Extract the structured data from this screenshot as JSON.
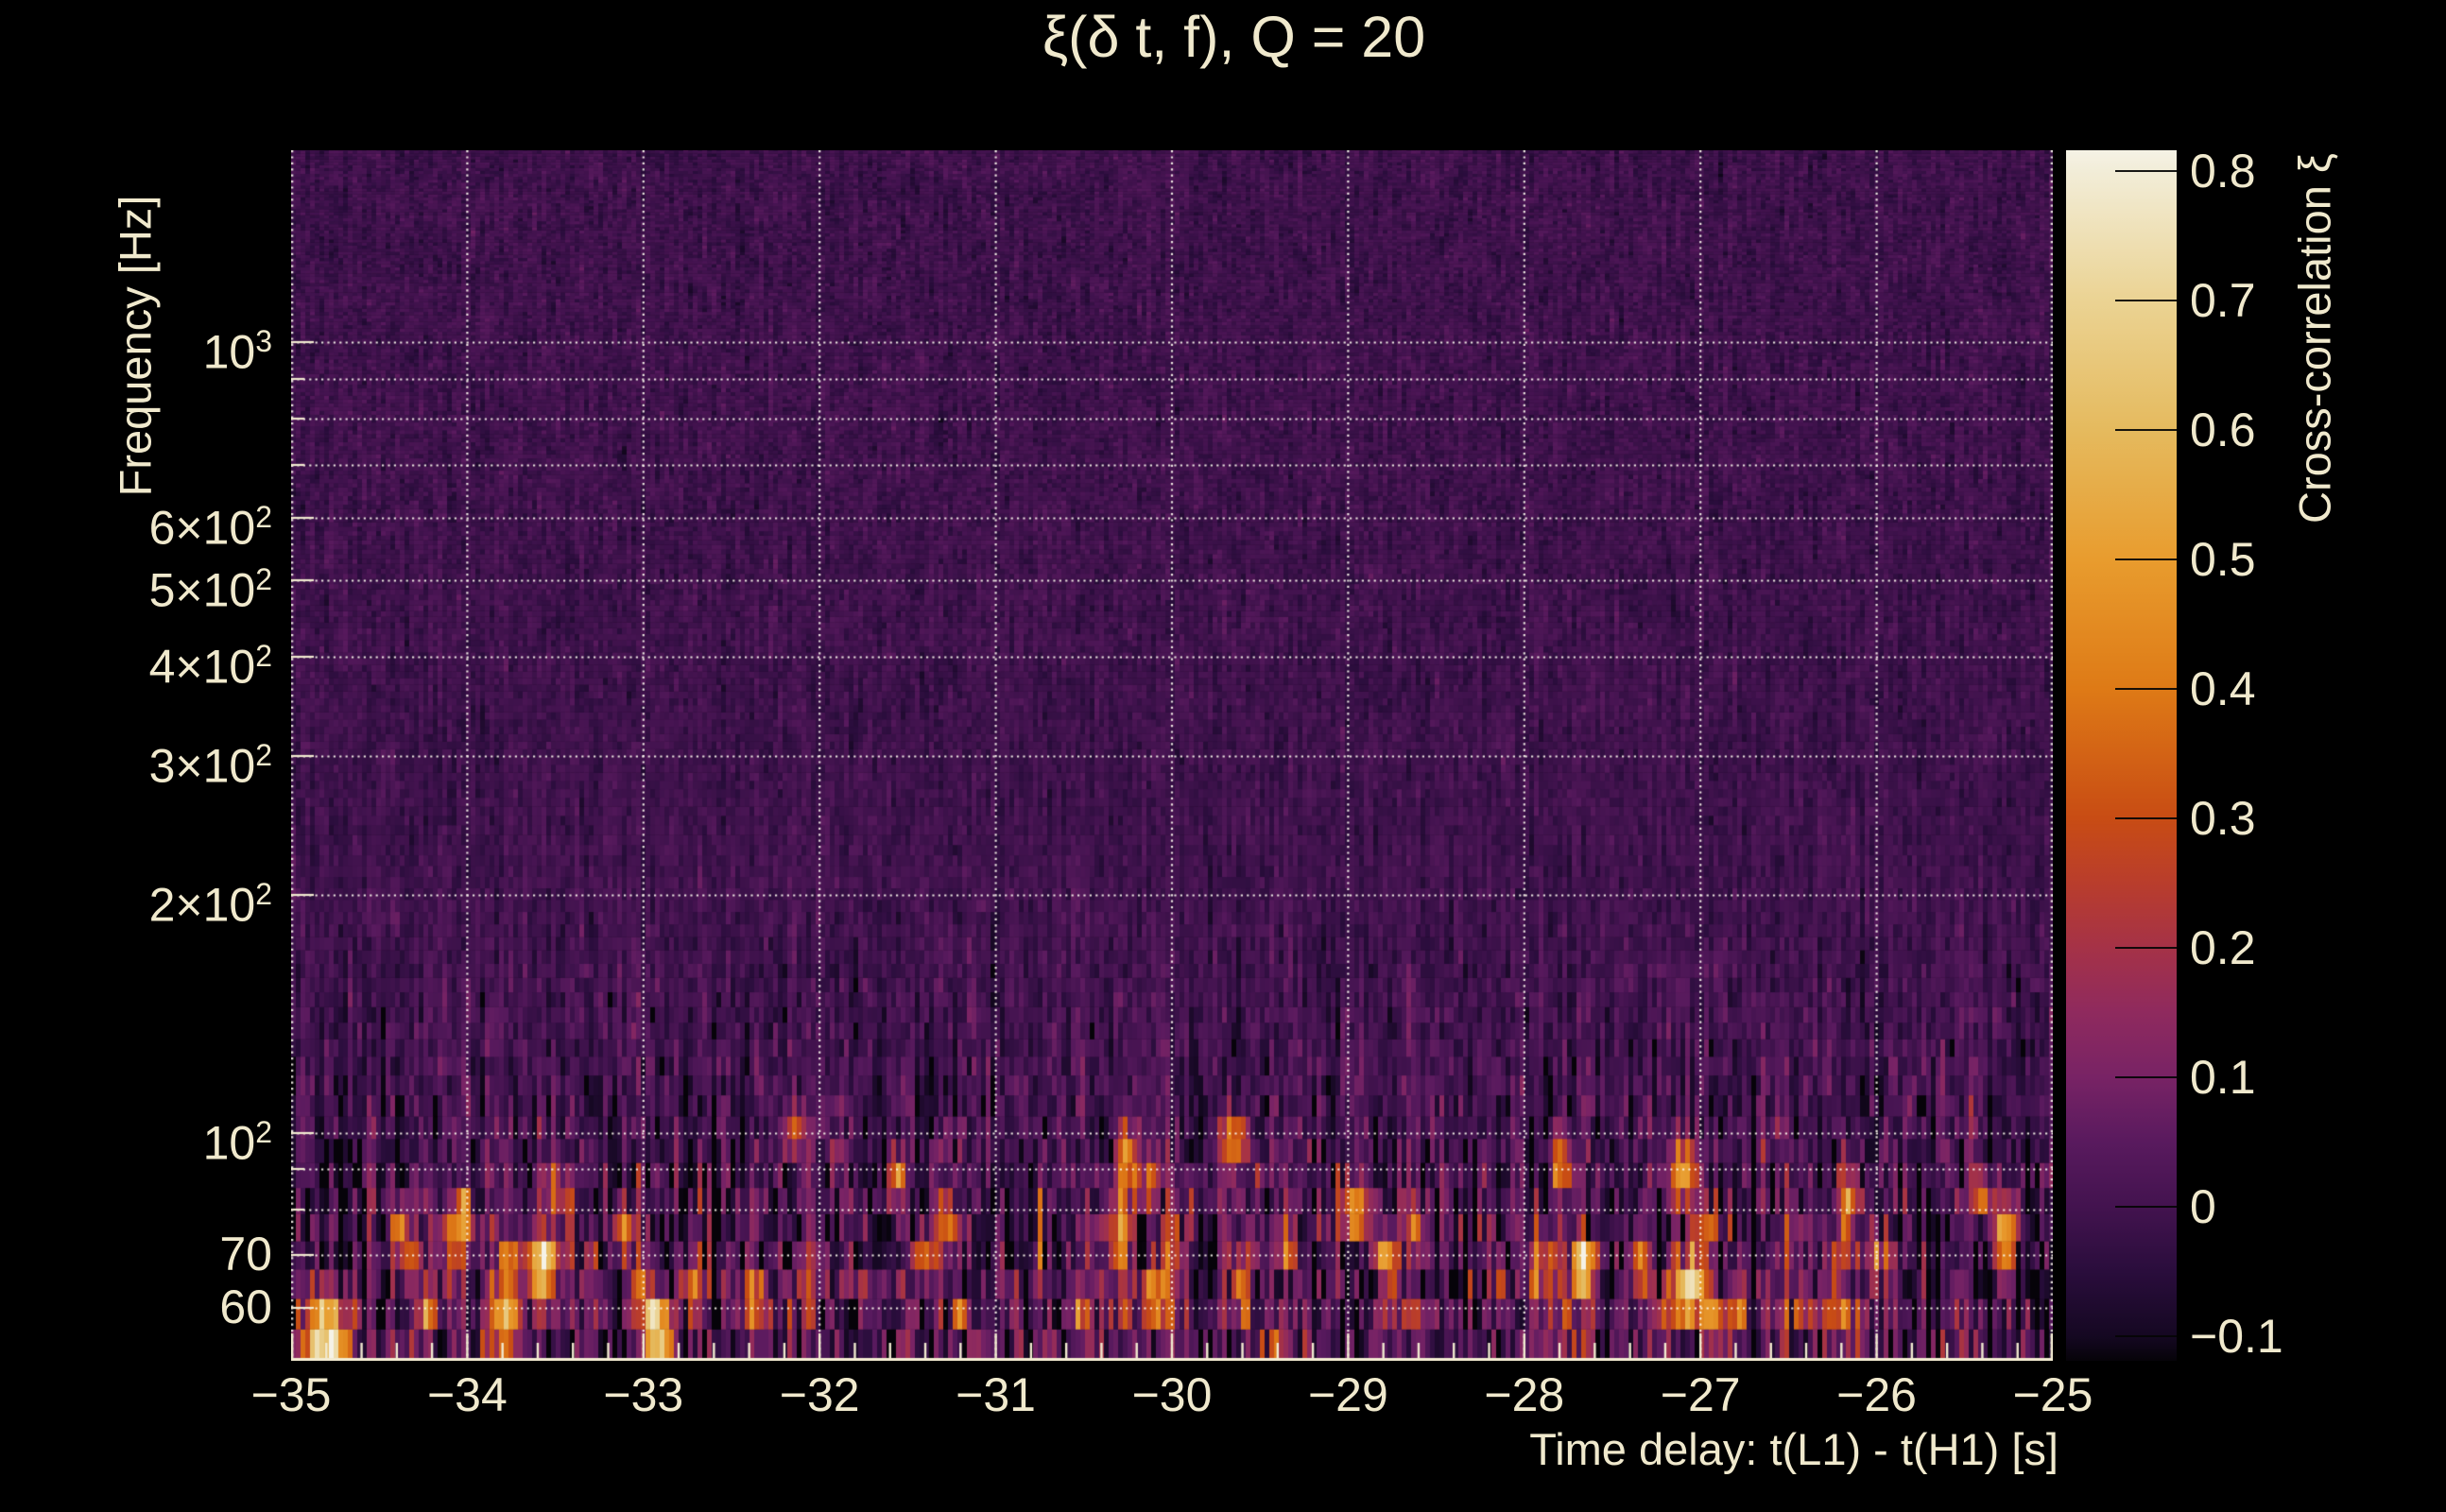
{
  "title": "ξ(δ t, f), Q = 20",
  "axes": {
    "x": {
      "label": "Time delay: t(L1) - t(H1) [s]",
      "min": -35,
      "max": -25,
      "ticks": [
        {
          "t": -35,
          "label": "−35"
        },
        {
          "t": -34,
          "label": "−34"
        },
        {
          "t": -33,
          "label": "−33"
        },
        {
          "t": -32,
          "label": "−32"
        },
        {
          "t": -31,
          "label": "−31"
        },
        {
          "t": -30,
          "label": "−30"
        },
        {
          "t": -29,
          "label": "−29"
        },
        {
          "t": -28,
          "label": "−28"
        },
        {
          "t": -27,
          "label": "−27"
        },
        {
          "t": -26,
          "label": "−26"
        },
        {
          "t": -25,
          "label": "−25"
        }
      ],
      "minor_tick_step_s": 0.2
    },
    "y": {
      "label": "Frequency [Hz]",
      "scale": "log",
      "min_hz": 51.5,
      "max_hz": 1750,
      "ticks": [
        {
          "f": 1000,
          "base": "10",
          "sup": "3"
        },
        {
          "f": 600,
          "base": "6×10",
          "sup": "2"
        },
        {
          "f": 500,
          "base": "5×10",
          "sup": "2"
        },
        {
          "f": 400,
          "base": "4×10",
          "sup": "2"
        },
        {
          "f": 300,
          "base": "3×10",
          "sup": "2"
        },
        {
          "f": 200,
          "base": "2×10",
          "sup": "2"
        },
        {
          "f": 100,
          "base": "10",
          "sup": "2"
        },
        {
          "f": 70,
          "base": "70",
          "sup": ""
        },
        {
          "f": 60,
          "base": "60",
          "sup": ""
        }
      ],
      "gridline_freqs_hz": [
        1000,
        900,
        800,
        700,
        600,
        500,
        400,
        300,
        200,
        100,
        90,
        80,
        70,
        60
      ]
    }
  },
  "colorbar": {
    "label": "Cross-correlation ξ",
    "vmin": -0.119,
    "vmax": 0.816,
    "ticks": [
      {
        "v": 0.8,
        "label": "0.8"
      },
      {
        "v": 0.7,
        "label": "0.7"
      },
      {
        "v": 0.6,
        "label": "0.6"
      },
      {
        "v": 0.5,
        "label": "0.5"
      },
      {
        "v": 0.4,
        "label": "0.4"
      },
      {
        "v": 0.3,
        "label": "0.3"
      },
      {
        "v": 0.2,
        "label": "0.2"
      },
      {
        "v": 0.1,
        "label": "0.1"
      },
      {
        "v": 0,
        "label": "0"
      },
      {
        "v": -0.1,
        "label": "−0.1"
      }
    ],
    "stops": [
      {
        "v": -0.119,
        "c": "#060309"
      },
      {
        "v": -0.1,
        "c": "#150822"
      },
      {
        "v": -0.05,
        "c": "#2a0d3c"
      },
      {
        "v": 0.0,
        "c": "#43134f"
      },
      {
        "v": 0.05,
        "c": "#591a5e"
      },
      {
        "v": 0.1,
        "c": "#782365"
      },
      {
        "v": 0.15,
        "c": "#8f2a5e"
      },
      {
        "v": 0.2,
        "c": "#a53247"
      },
      {
        "v": 0.25,
        "c": "#b93d2c"
      },
      {
        "v": 0.3,
        "c": "#c84c14"
      },
      {
        "v": 0.4,
        "c": "#de7a16"
      },
      {
        "v": 0.5,
        "c": "#e89c2e"
      },
      {
        "v": 0.6,
        "c": "#e5ba5e"
      },
      {
        "v": 0.7,
        "c": "#ebd393"
      },
      {
        "v": 0.8,
        "c": "#f2edd8"
      },
      {
        "v": 0.816,
        "c": "#f5f2e6"
      }
    ]
  },
  "style_colors": {
    "background": "#000000",
    "text": "#f0e9cd",
    "gridline": "rgba(252,248,238,0.92)",
    "axis_spine": "#f1ead0"
  },
  "chart_data": {
    "type": "heatmap",
    "title": "ξ(δ t, f), Q = 20",
    "xlabel": "Time delay: t(L1) - t(H1) [s]",
    "ylabel": "Frequency [Hz]",
    "colorbar_label": "Cross-correlation ξ",
    "x_range_s": [
      -35,
      -25
    ],
    "y_scale": "log",
    "y_range_hz": [
      51.5,
      1750
    ],
    "color_range_xi": [
      -0.119,
      0.816
    ],
    "x_tick_labels": [
      "−35",
      "−34",
      "−33",
      "−32",
      "−31",
      "−30",
      "−29",
      "−28",
      "−27",
      "−26",
      "−25"
    ],
    "y_tick_labels": [
      "10³",
      "6×10²",
      "5×10²",
      "4×10²",
      "3×10²",
      "2×10²",
      "10²",
      "70",
      "60"
    ],
    "colorbar_tick_labels": [
      "0.8",
      "0.7",
      "0.6",
      "0.5",
      "0.4",
      "0.3",
      "0.2",
      "0.1",
      "0",
      "−0.1"
    ],
    "grid": true,
    "legend_position": "right-colorbar",
    "background_character": "cross-correlation noise map; variance and bright positive outliers concentrated below ~200 Hz",
    "hotspots_estimated": [
      {
        "time_delay_s": -34.8,
        "frequency_hz": 56,
        "xi": 0.62,
        "dt_s": 0.07,
        "df_dex": 0.028
      },
      {
        "time_delay_s": -34.78,
        "frequency_hz": 52,
        "xi": 0.5,
        "dt_s": 0.1,
        "df_dex": 0.016
      },
      {
        "time_delay_s": -34.38,
        "frequency_hz": 73,
        "xi": 0.48,
        "dt_s": 0.04,
        "df_dex": 0.022
      },
      {
        "time_delay_s": -34.02,
        "frequency_hz": 77,
        "xi": 0.4,
        "dt_s": 0.04,
        "df_dex": 0.02
      },
      {
        "time_delay_s": -33.56,
        "frequency_hz": 66,
        "xi": 0.58,
        "dt_s": 0.05,
        "df_dex": 0.028
      },
      {
        "time_delay_s": -33.1,
        "frequency_hz": 72,
        "xi": 0.5,
        "dt_s": 0.04,
        "df_dex": 0.024
      },
      {
        "time_delay_s": -32.92,
        "frequency_hz": 54,
        "xi": 0.9,
        "dt_s": 0.055,
        "df_dex": 0.026
      },
      {
        "time_delay_s": -32.15,
        "frequency_hz": 96,
        "xi": 0.35,
        "dt_s": 0.04,
        "df_dex": 0.02
      },
      {
        "time_delay_s": -31.55,
        "frequency_hz": 85,
        "xi": 0.42,
        "dt_s": 0.04,
        "df_dex": 0.02
      },
      {
        "time_delay_s": -31.3,
        "frequency_hz": 75,
        "xi": 0.45,
        "dt_s": 0.05,
        "df_dex": 0.022
      },
      {
        "time_delay_s": -30.25,
        "frequency_hz": 90,
        "xi": 0.5,
        "dt_s": 0.04,
        "df_dex": 0.03
      },
      {
        "time_delay_s": -30.0,
        "frequency_hz": 70,
        "xi": 0.42,
        "dt_s": 0.04,
        "df_dex": 0.022
      },
      {
        "time_delay_s": -29.65,
        "frequency_hz": 95,
        "xi": 0.45,
        "dt_s": 0.05,
        "df_dex": 0.024
      },
      {
        "time_delay_s": -29.4,
        "frequency_hz": 52,
        "xi": 0.32,
        "dt_s": 0.05,
        "df_dex": 0.015
      },
      {
        "time_delay_s": -28.95,
        "frequency_hz": 77,
        "xi": 0.55,
        "dt_s": 0.05,
        "df_dex": 0.026
      },
      {
        "time_delay_s": -28.78,
        "frequency_hz": 68,
        "xi": 0.48,
        "dt_s": 0.04,
        "df_dex": 0.022
      },
      {
        "time_delay_s": -27.8,
        "frequency_hz": 88,
        "xi": 0.4,
        "dt_s": 0.04,
        "df_dex": 0.022
      },
      {
        "time_delay_s": -27.65,
        "frequency_hz": 54,
        "xi": 0.34,
        "dt_s": 0.05,
        "df_dex": 0.015
      },
      {
        "time_delay_s": -27.1,
        "frequency_hz": 86,
        "xi": 0.55,
        "dt_s": 0.05,
        "df_dex": 0.03
      },
      {
        "time_delay_s": -26.95,
        "frequency_hz": 74,
        "xi": 0.4,
        "dt_s": 0.04,
        "df_dex": 0.02
      },
      {
        "time_delay_s": -26.15,
        "frequency_hz": 79,
        "xi": 0.45,
        "dt_s": 0.04,
        "df_dex": 0.024
      },
      {
        "time_delay_s": -25.4,
        "frequency_hz": 81,
        "xi": 0.48,
        "dt_s": 0.04,
        "df_dex": 0.022
      },
      {
        "time_delay_s": -25.28,
        "frequency_hz": 72,
        "xi": 0.55,
        "dt_s": 0.045,
        "df_dex": 0.028
      }
    ]
  }
}
